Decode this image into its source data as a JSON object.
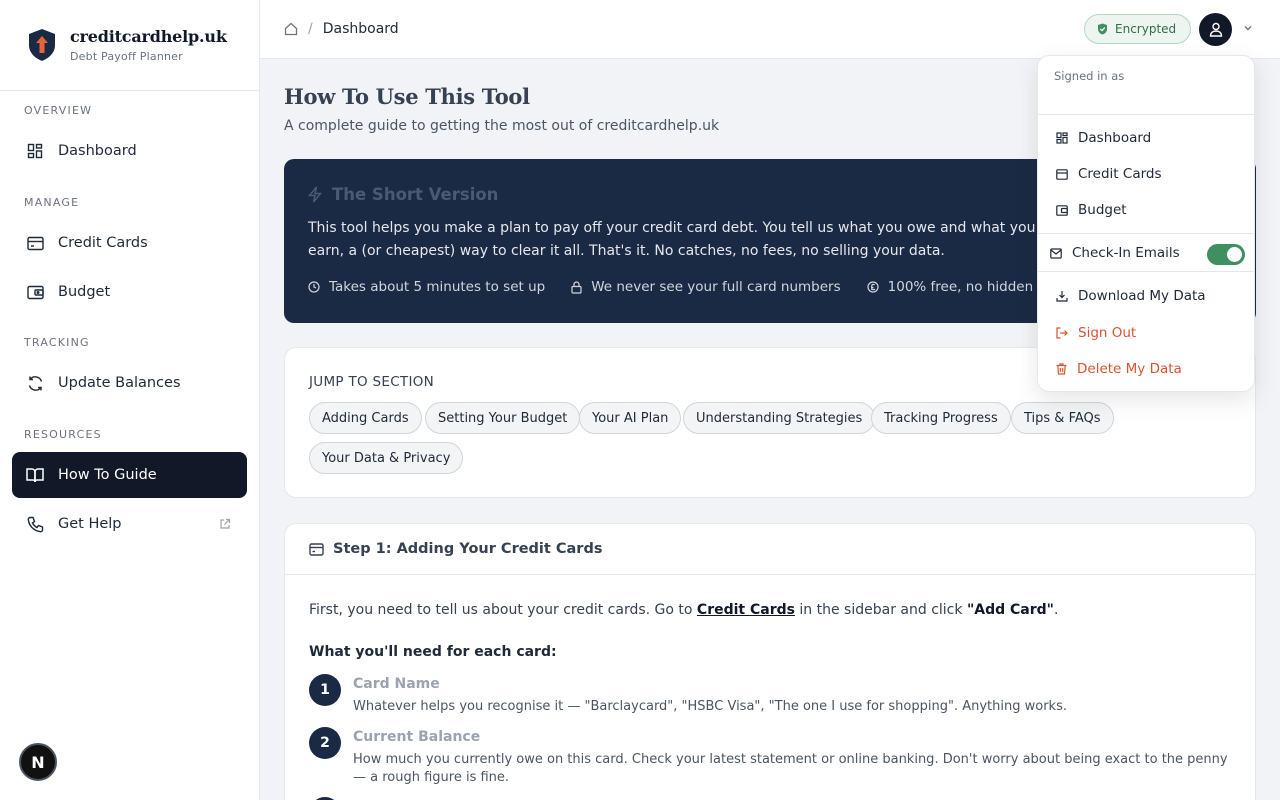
{
  "brand": {
    "title": "creditcardhelp.uk",
    "subtitle": "Debt Payoff Planner"
  },
  "sidebar": {
    "sections": [
      "OVERVIEW",
      "MANAGE",
      "TRACKING",
      "RESOURCES"
    ],
    "items": [
      {
        "label": "Dashboard",
        "icon": "grid-icon"
      },
      {
        "label": "Credit Cards",
        "icon": "card-icon"
      },
      {
        "label": "Budget",
        "icon": "wallet-icon"
      },
      {
        "label": "Update Balances",
        "icon": "refresh-icon"
      },
      {
        "label": "How To Guide",
        "icon": "book-icon",
        "active": true
      },
      {
        "label": "Get Help",
        "icon": "phone-icon",
        "external": true
      }
    ],
    "bottom_badge": "N"
  },
  "header": {
    "breadcrumb_current": "Dashboard",
    "encrypted_label": "Encrypted"
  },
  "main": {
    "title": "How To Use This Tool",
    "subtitle": "A complete guide to getting the most out of creditcardhelp.uk",
    "short": {
      "title": "The Short Version",
      "text": "This tool helps you make a plan to pay off your credit card debt. You tell us what you owe and what you earn, a (or cheapest) way to clear it all. That's it. No catches, no fees, no selling your data.",
      "facts": [
        "Takes about 5 minutes to set up",
        "We never see your full card numbers",
        "100% free, no hidden costs"
      ]
    },
    "jump": {
      "title": "JUMP TO SECTION",
      "chips": [
        "Adding Cards",
        "Setting Your Budget",
        "Your AI Plan",
        "Understanding Strategies",
        "Tracking Progress",
        "Tips & FAQs",
        "Your Data & Privacy"
      ]
    },
    "step1": {
      "title": "Step 1: Adding Your Credit Cards",
      "intro_pre": "First, you need to tell us about your credit cards. Go to ",
      "intro_link": "Credit Cards",
      "intro_mid": " in the sidebar and click ",
      "intro_bold": "\"Add Card\"",
      "intro_end": ".",
      "need_title": "What you'll need for each card:",
      "items": [
        {
          "num": "1",
          "title": "Card Name",
          "desc": "Whatever helps you recognise it — \"Barclaycard\", \"HSBC Visa\", \"The one I use for shopping\". Anything works."
        },
        {
          "num": "2",
          "title": "Current Balance",
          "desc": "How much you currently owe on this card. Check your latest statement or online banking. Don't worry about being exact to the penny — a rough figure is fine."
        }
      ]
    }
  },
  "menu": {
    "signed_in": "Signed in as",
    "nav": [
      "Dashboard",
      "Credit Cards",
      "Budget"
    ],
    "checkin_label": "Check-In Emails",
    "checkin_enabled": true,
    "download": "Download My Data",
    "signout": "Sign Out",
    "delete": "Delete My Data"
  },
  "colors": {
    "navy": "#1b2a44",
    "active": "#111827",
    "accent_green": "#3f8f61",
    "danger": "#d6542f",
    "logo_orange": "#e8633a"
  }
}
